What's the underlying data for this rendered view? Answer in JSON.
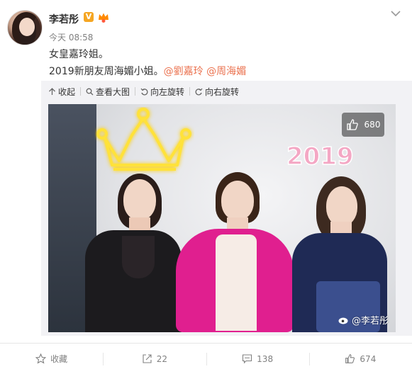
{
  "post": {
    "author": "李若彤",
    "verified_badge": "V",
    "time": "今天 08:58",
    "line1": "女皇嘉玲姐。",
    "line2_prefix": "2019新朋友周海媚小姐。",
    "mention1": "@劉嘉玲",
    "mention2": "@周海媚"
  },
  "media_toolbar": {
    "collapse": "收起",
    "view_large": "查看大图",
    "rotate_left": "向左旋转",
    "rotate_right": "向右旋转"
  },
  "photo": {
    "likes": "680",
    "watermark": "@李若彤",
    "deco_text": "2019"
  },
  "footer": {
    "favorite": "收藏",
    "repost_count": "22",
    "comment_count": "138",
    "like_count": "674"
  },
  "colors": {
    "mention": "#eb7350",
    "verified": "#f5a623"
  }
}
